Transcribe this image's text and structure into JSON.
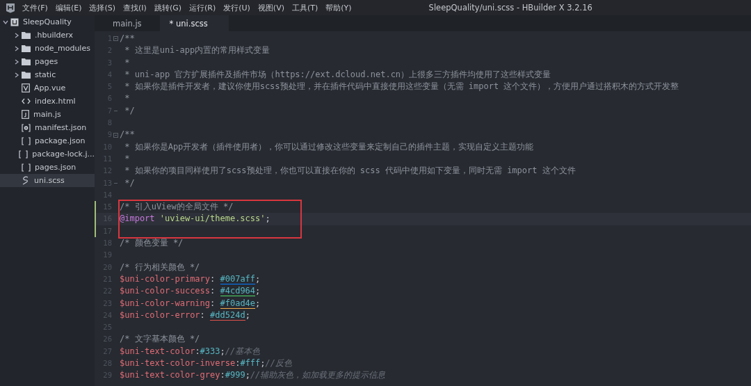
{
  "menu_bar": {
    "items": [
      "文件(F)",
      "编辑(E)",
      "选择(S)",
      "查找(I)",
      "跳转(G)",
      "运行(R)",
      "发行(U)",
      "视图(V)",
      "工具(T)",
      "帮助(Y)"
    ],
    "title": "SleepQuality/uni.scss - HBuilder X 3.2.16"
  },
  "tabs": [
    {
      "label": "main.js",
      "selected": false
    },
    {
      "label": "* uni.scss",
      "selected": true
    }
  ],
  "sidebar": {
    "project": {
      "name": "SleepQuality",
      "expanded": true,
      "children": [
        {
          "name": ".hbuilderx",
          "kind": "folder",
          "expanded": false,
          "selected": false
        },
        {
          "name": "node_modules",
          "kind": "folder",
          "expanded": false,
          "selected": false
        },
        {
          "name": "pages",
          "kind": "folder",
          "expanded": false,
          "selected": false
        },
        {
          "name": "static",
          "kind": "folder",
          "expanded": false,
          "selected": false
        },
        {
          "name": "App.vue",
          "kind": "vue",
          "selected": false
        },
        {
          "name": "index.html",
          "kind": "html",
          "selected": false
        },
        {
          "name": "main.js",
          "kind": "js",
          "selected": false
        },
        {
          "name": "manifest.json",
          "kind": "manifest",
          "selected": false
        },
        {
          "name": "package.json",
          "kind": "json",
          "selected": false
        },
        {
          "name": "package-lock.j...",
          "kind": "json",
          "selected": false
        },
        {
          "name": "pages.json",
          "kind": "json",
          "selected": false
        },
        {
          "name": "uni.scss",
          "kind": "scss",
          "selected": true
        }
      ]
    }
  },
  "editor": {
    "blocks": [
      {
        "lines": [
          {
            "number": "1",
            "fold_start": true,
            "tokens": [
              {
                "kind": "comment",
                "text": "/**"
              }
            ]
          },
          {
            "number": "2",
            "tokens": [
              {
                "kind": "comment",
                "text": " * 这里是uni-app内置的常用样式变量"
              }
            ]
          },
          {
            "number": "3",
            "tokens": [
              {
                "kind": "comment",
                "text": " *"
              }
            ]
          },
          {
            "number": "4",
            "tokens": [
              {
                "kind": "comment",
                "text": " * uni-app 官方扩展插件及插件市场（https://ext.dcloud.net.cn）上很多三方插件均使用了这些样式变量"
              }
            ]
          },
          {
            "number": "5",
            "tokens": [
              {
                "kind": "comment",
                "text": " * 如果你是插件开发者，建议你使用scss预处理，并在插件代码中直接使用这些变量（无需 import 这个文件），方便用户通过搭积木的方式开发整"
              }
            ]
          },
          {
            "number": "6",
            "tokens": [
              {
                "kind": "comment",
                "text": " *"
              }
            ]
          },
          {
            "number": "7",
            "fold_end": true,
            "tokens": [
              {
                "kind": "comment",
                "text": " */"
              }
            ]
          },
          {
            "number": "8"
          },
          {
            "number": "9",
            "fold_start": true,
            "tokens": [
              {
                "kind": "comment",
                "text": "/**"
              }
            ]
          },
          {
            "number": "10",
            "tokens": [
              {
                "kind": "comment",
                "text": " * 如果你是App开发者（插件使用者），你可以通过修改这些变量来定制自己的插件主题，实现自定义主题功能"
              }
            ]
          },
          {
            "number": "11",
            "tokens": [
              {
                "kind": "comment",
                "text": " *"
              }
            ]
          },
          {
            "number": "12",
            "tokens": [
              {
                "kind": "comment",
                "text": " * 如果你的项目同样使用了scss预处理，你也可以直接在你的 scss 代码中使用如下变量，同时无需 import 这个文件"
              }
            ]
          },
          {
            "number": "13",
            "fold_end": true,
            "tokens": [
              {
                "kind": "comment",
                "text": " */"
              }
            ]
          },
          {
            "number": "14"
          }
        ]
      },
      {
        "boxed": true,
        "modified": true,
        "lines": [
          {
            "number": "15",
            "tokens": [
              {
                "kind": "comment",
                "text": "/* 引入uView的全局文件 */"
              }
            ]
          },
          {
            "number": "16",
            "current": true,
            "tokens": [
              {
                "kind": "keyword",
                "text": "@import"
              },
              {
                "kind": "string",
                "text": "'uview-ui/theme.scss'"
              },
              {
                "kind": "punct",
                "text": ";"
              }
            ]
          },
          {
            "number": "17"
          }
        ]
      },
      {
        "lines": [
          {
            "number": "18",
            "tokens": [
              {
                "kind": "comment",
                "text": "/* 颜色变量 */"
              }
            ]
          },
          {
            "number": "19"
          },
          {
            "number": "20",
            "tokens": [
              {
                "kind": "comment",
                "text": "/* 行为相关颜色 */"
              }
            ]
          },
          {
            "number": "21",
            "tokens": [
              {
                "kind": "variable",
                "text": "$uni-color-primary"
              },
              {
                "kind": "punct",
                "text": ": "
              },
              {
                "kind": "hex",
                "text": "#007aff",
                "color": "#007aff"
              },
              {
                "kind": "punct",
                "text": ";"
              }
            ]
          },
          {
            "number": "22",
            "tokens": [
              {
                "kind": "variable",
                "text": "$uni-color-success"
              },
              {
                "kind": "punct",
                "text": ": "
              },
              {
                "kind": "hex",
                "text": "#4cd964",
                "color": "#4cd964"
              },
              {
                "kind": "punct",
                "text": ";"
              }
            ]
          },
          {
            "number": "23",
            "tokens": [
              {
                "kind": "variable",
                "text": "$uni-color-warning"
              },
              {
                "kind": "punct",
                "text": ": "
              },
              {
                "kind": "hex",
                "text": "#f0ad4e",
                "color": "#f0ad4e"
              },
              {
                "kind": "punct",
                "text": ";"
              }
            ]
          },
          {
            "number": "24",
            "tokens": [
              {
                "kind": "variable",
                "text": "$uni-color-error"
              },
              {
                "kind": "punct",
                "text": ": "
              },
              {
                "kind": "hex",
                "text": "#dd524d",
                "color": "#dd524d"
              },
              {
                "kind": "punct",
                "text": ";"
              }
            ]
          },
          {
            "number": "25"
          },
          {
            "number": "26",
            "tokens": [
              {
                "kind": "comment",
                "text": "/* 文字基本颜色 */"
              }
            ]
          },
          {
            "number": "27",
            "tokens": [
              {
                "kind": "variable",
                "text": "$uni-text-color"
              },
              {
                "kind": "punct",
                "text": ":"
              },
              {
                "kind": "number",
                "text": "#333"
              },
              {
                "kind": "punct",
                "text": ";"
              },
              {
                "kind": "linecomment",
                "text": "//基本色"
              }
            ]
          },
          {
            "number": "28",
            "tokens": [
              {
                "kind": "variable",
                "text": "$uni-text-color-inverse"
              },
              {
                "kind": "punct",
                "text": ":"
              },
              {
                "kind": "number",
                "text": "#fff"
              },
              {
                "kind": "punct",
                "text": ";"
              },
              {
                "kind": "linecomment",
                "text": "//反色"
              }
            ]
          },
          {
            "number": "29",
            "tokens": [
              {
                "kind": "variable",
                "text": "$uni-text-color-grey"
              },
              {
                "kind": "punct",
                "text": ":"
              },
              {
                "kind": "number",
                "text": "#999"
              },
              {
                "kind": "punct",
                "text": ";"
              },
              {
                "kind": "linecomment",
                "text": "//辅助灰色，如加载更多的提示信息"
              }
            ]
          }
        ]
      }
    ]
  }
}
